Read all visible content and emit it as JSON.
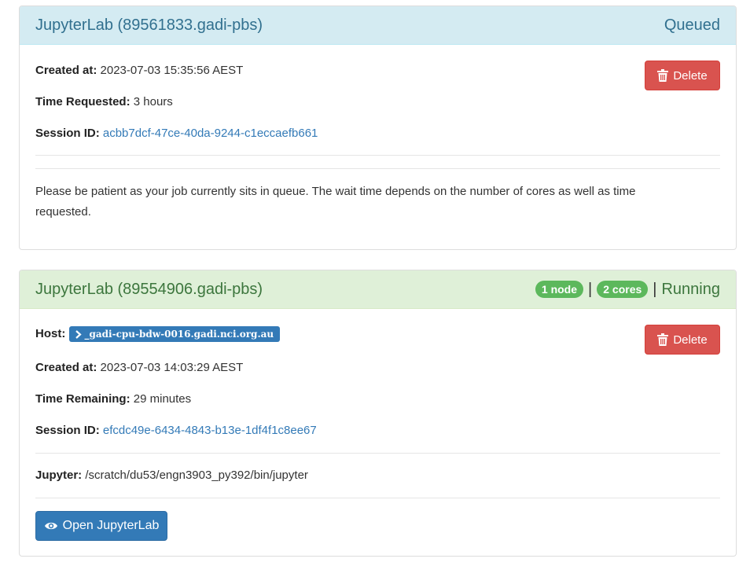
{
  "sessions": [
    {
      "title": "JupyterLab (89561833.gadi-pbs)",
      "status": "Queued",
      "delete_label": "Delete",
      "created_label": "Created at:",
      "created_value": "2023-07-03 15:35:56 AEST",
      "time_label": "Time Requested:",
      "time_value": "3 hours",
      "session_label": "Session ID:",
      "session_value": "acbb7dcf-47ce-40da-9244-c1eccaefb661",
      "message": "Please be patient as your job currently sits in queue. The wait time depends on the number of cores as well as time requested."
    },
    {
      "title": "JupyterLab (89554906.gadi-pbs)",
      "nodes_badge": "1 node",
      "cores_badge": "2 cores",
      "separator": "|",
      "status": "Running",
      "delete_label": "Delete",
      "host_label": "Host:",
      "host_value": "_gadi-cpu-bdw-0016.gadi.nci.org.au",
      "created_label": "Created at:",
      "created_value": "2023-07-03 14:03:29 AEST",
      "time_label": "Time Remaining:",
      "time_value": "29 minutes",
      "session_label": "Session ID:",
      "session_value": "efcdc49e-6434-4843-b13e-1df4f1c8ee67",
      "jupyter_label": "Jupyter:",
      "jupyter_value": "/scratch/du53/engn3903_py392/bin/jupyter",
      "open_label": "Open JupyterLab"
    }
  ],
  "colors": {
    "info_header_bg": "#d4ebf2",
    "success_header_bg": "#dff0d8",
    "danger": "#d9534f",
    "primary": "#337ab7",
    "badge_green": "#5cb85c"
  },
  "icons": [
    "trash-icon",
    "terminal-icon",
    "eye-icon"
  ]
}
